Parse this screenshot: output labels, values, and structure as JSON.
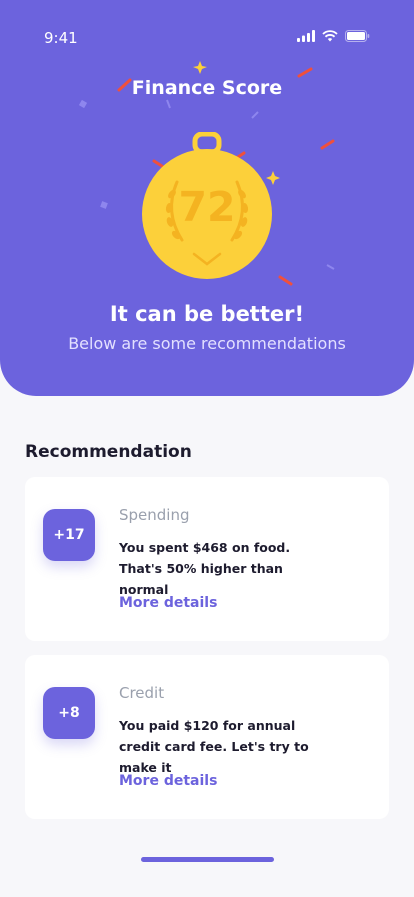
{
  "status_bar": {
    "time": "9:41"
  },
  "header": {
    "title": "Finance Score",
    "score": "72",
    "headline": "It can be better!",
    "subline": "Below are some recommendations"
  },
  "colors": {
    "primary": "#6c63dd",
    "medal": "#fcd03a",
    "medal_text": "#f4b321"
  },
  "recommendation": {
    "title": "Recommendation",
    "cards": [
      {
        "badge": "+17",
        "category": "Spending",
        "description": "You spent $468 on food. That's 50% higher than normal",
        "link": "More details"
      },
      {
        "badge": "+8",
        "category": "Credit",
        "description": "You paid $120 for annual credit card fee. Let's try to make it",
        "link": "More details"
      }
    ]
  }
}
